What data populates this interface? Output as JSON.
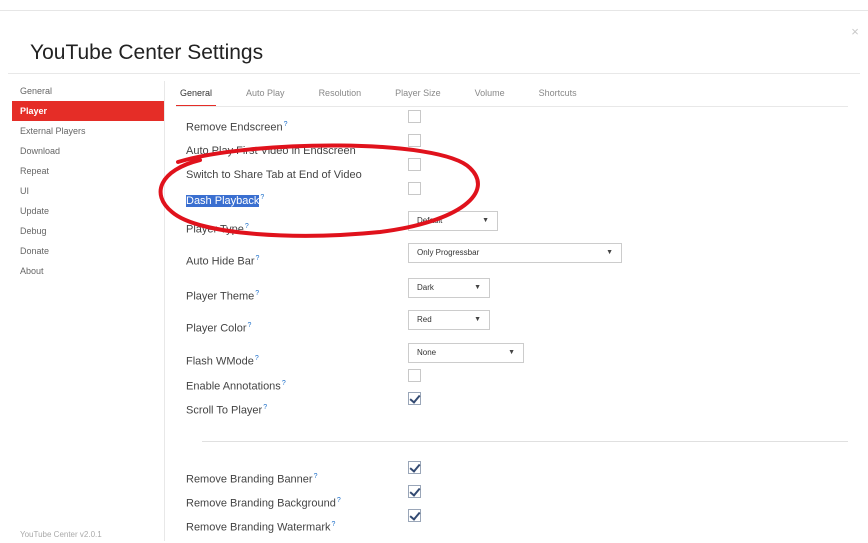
{
  "title": "YouTube Center Settings",
  "close_icon": "×",
  "sidebar": {
    "items": [
      {
        "label": "General"
      },
      {
        "label": "Player"
      },
      {
        "label": "External Players"
      },
      {
        "label": "Download"
      },
      {
        "label": "Repeat"
      },
      {
        "label": "UI"
      },
      {
        "label": "Update"
      },
      {
        "label": "Debug"
      },
      {
        "label": "Donate"
      },
      {
        "label": "About"
      }
    ],
    "active": "Player",
    "version": "YouTube Center v2.0.1"
  },
  "tabs": [
    {
      "label": "General"
    },
    {
      "label": "Auto Play"
    },
    {
      "label": "Resolution"
    },
    {
      "label": "Player Size"
    },
    {
      "label": "Volume"
    },
    {
      "label": "Shortcuts"
    }
  ],
  "active_tab": "General",
  "settings": {
    "remove_endscreen": {
      "label": "Remove Endscreen",
      "checked": false
    },
    "autoplay_first_video": {
      "label": "Auto Play First Video in Endscreen",
      "checked": false
    },
    "switch_share_tab": {
      "label": "Switch to Share Tab at End of Video",
      "checked": false
    },
    "dash_playback": {
      "label": "Dash Playback",
      "checked": false
    },
    "player_type": {
      "label": "Player Type",
      "value": "Default"
    },
    "auto_hide_bar": {
      "label": "Auto Hide Bar",
      "value": "Only Progressbar"
    },
    "player_theme": {
      "label": "Player Theme",
      "value": "Dark"
    },
    "player_color": {
      "label": "Player Color",
      "value": "Red"
    },
    "flash_wmode": {
      "label": "Flash WMode",
      "value": "None"
    },
    "enable_annotations": {
      "label": "Enable Annotations",
      "checked": false
    },
    "scroll_to_player": {
      "label": "Scroll To Player",
      "checked": true
    },
    "remove_branding_banner": {
      "label": "Remove Branding Banner",
      "checked": true
    },
    "remove_branding_background": {
      "label": "Remove Branding Background",
      "checked": true
    },
    "remove_branding_watermark": {
      "label": "Remove Branding Watermark",
      "checked": true
    }
  },
  "help_mark": "?",
  "colors": {
    "accent": "#e52d27",
    "annotation": "#e0121c",
    "help": "#1d6fc9"
  }
}
